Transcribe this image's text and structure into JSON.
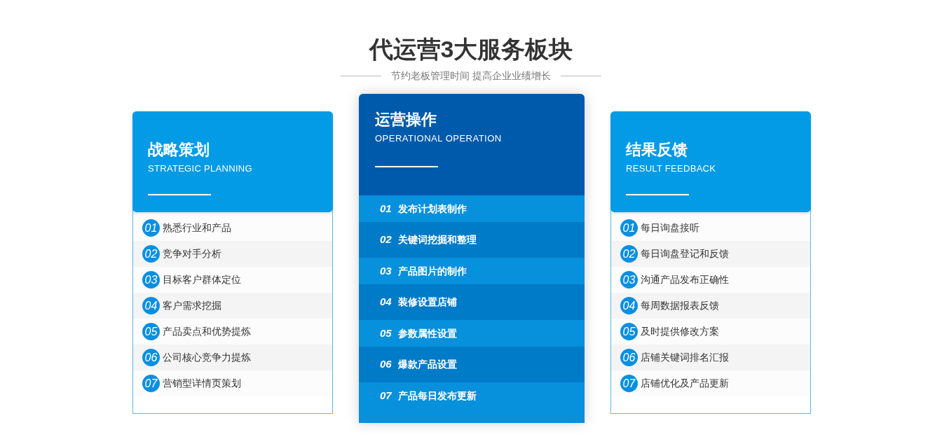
{
  "heading": {
    "title": "代运营3大服务板块",
    "subtitle": "节约老板管理时间 提高企业业绩增长"
  },
  "cards": [
    {
      "kind": "plain",
      "title": "战略策划",
      "subtitle": "STRATEGIC PLANNING",
      "items": [
        {
          "number": "01",
          "text": "熟悉行业和产品"
        },
        {
          "number": "02",
          "text": "竞争对手分析"
        },
        {
          "number": "03",
          "text": "目标客户群体定位"
        },
        {
          "number": "04",
          "text": "客户需求挖掘"
        },
        {
          "number": "05",
          "text": "产品卖点和优势提炼"
        },
        {
          "number": "06",
          "text": "公司核心竞争力提炼"
        },
        {
          "number": "07",
          "text": "营销型详情页策划"
        }
      ]
    },
    {
      "kind": "featured",
      "title": "运营操作",
      "subtitle": "OPERATIONAL OPERATION",
      "items": [
        {
          "number": "01",
          "text": "发布计划表制作"
        },
        {
          "number": "02",
          "text": "关键词挖掘和整理"
        },
        {
          "number": "03",
          "text": "产品图片的制作"
        },
        {
          "number": "04",
          "text": "装修设置店铺"
        },
        {
          "number": "05",
          "text": "参数属性设置"
        },
        {
          "number": "06",
          "text": "爆款产品设置"
        },
        {
          "number": "07",
          "text": "产品每日发布更新"
        }
      ]
    },
    {
      "kind": "plain",
      "title": "结果反馈",
      "subtitle": "RESULT FEEDBACK",
      "items": [
        {
          "number": "01",
          "text": "每日询盘接听"
        },
        {
          "number": "02",
          "text": "每日询盘登记和反馈"
        },
        {
          "number": "03",
          "text": "沟通产品发布正确性"
        },
        {
          "number": "04",
          "text": "每周数据报表反馈"
        },
        {
          "number": "05",
          "text": "及时提供修改方案"
        },
        {
          "number": "06",
          "text": "店铺关键词排名汇报"
        },
        {
          "number": "07",
          "text": "店铺优化及产品更新"
        }
      ]
    }
  ]
}
